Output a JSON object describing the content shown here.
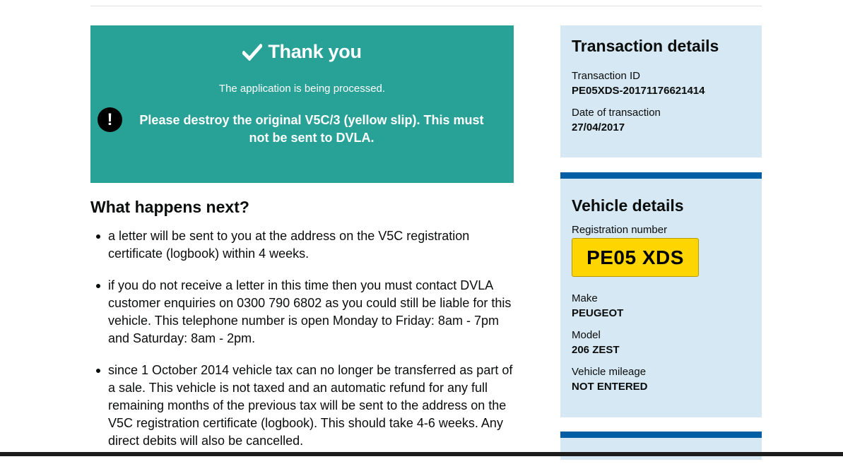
{
  "confirmation": {
    "title": "Thank you",
    "subtitle": "The application is being processed.",
    "warning": "Please destroy the original V5C/3 (yellow slip). This must not be sent to DVLA.",
    "icons": {
      "title": "checkmark-icon",
      "warning": "exclamation-icon"
    }
  },
  "next": {
    "heading": "What happens next?",
    "items": [
      "a letter will be sent to you at the address on the V5C registration certificate (logbook) within 4 weeks.",
      "if you do not receive a letter in this time then you must contact DVLA customer enquiries on 0300 790 6802 as you could still be liable for this vehicle. This telephone number is open Monday to Friday: 8am - 7pm and Saturday: 8am - 2pm.",
      "since 1 October 2014 vehicle tax can no longer be transferred as part of a sale. This vehicle is not taxed and an automatic refund for any full remaining months of the previous tax will be sent to the address on the V5C registration certificate (logbook). This should take 4-6 weeks. Any direct debits will also be cancelled."
    ]
  },
  "transaction": {
    "heading": "Transaction details",
    "id_label": "Transaction ID",
    "id_value": "PE05XDS-20171176621414",
    "date_label": "Date of transaction",
    "date_value": "27/04/2017"
  },
  "vehicle": {
    "heading": "Vehicle details",
    "reg_label": "Registration number",
    "reg_value": "PE05 XDS",
    "make_label": "Make",
    "make_value": "PEUGEOT",
    "model_label": "Model",
    "model_value": "206 ZEST",
    "mileage_label": "Vehicle mileage",
    "mileage_value": "NOT ENTERED"
  },
  "colors": {
    "panel": "#28a197",
    "sidebar": "#d5e8f3",
    "accent": "#005ea5",
    "plate": "#ffd500"
  }
}
